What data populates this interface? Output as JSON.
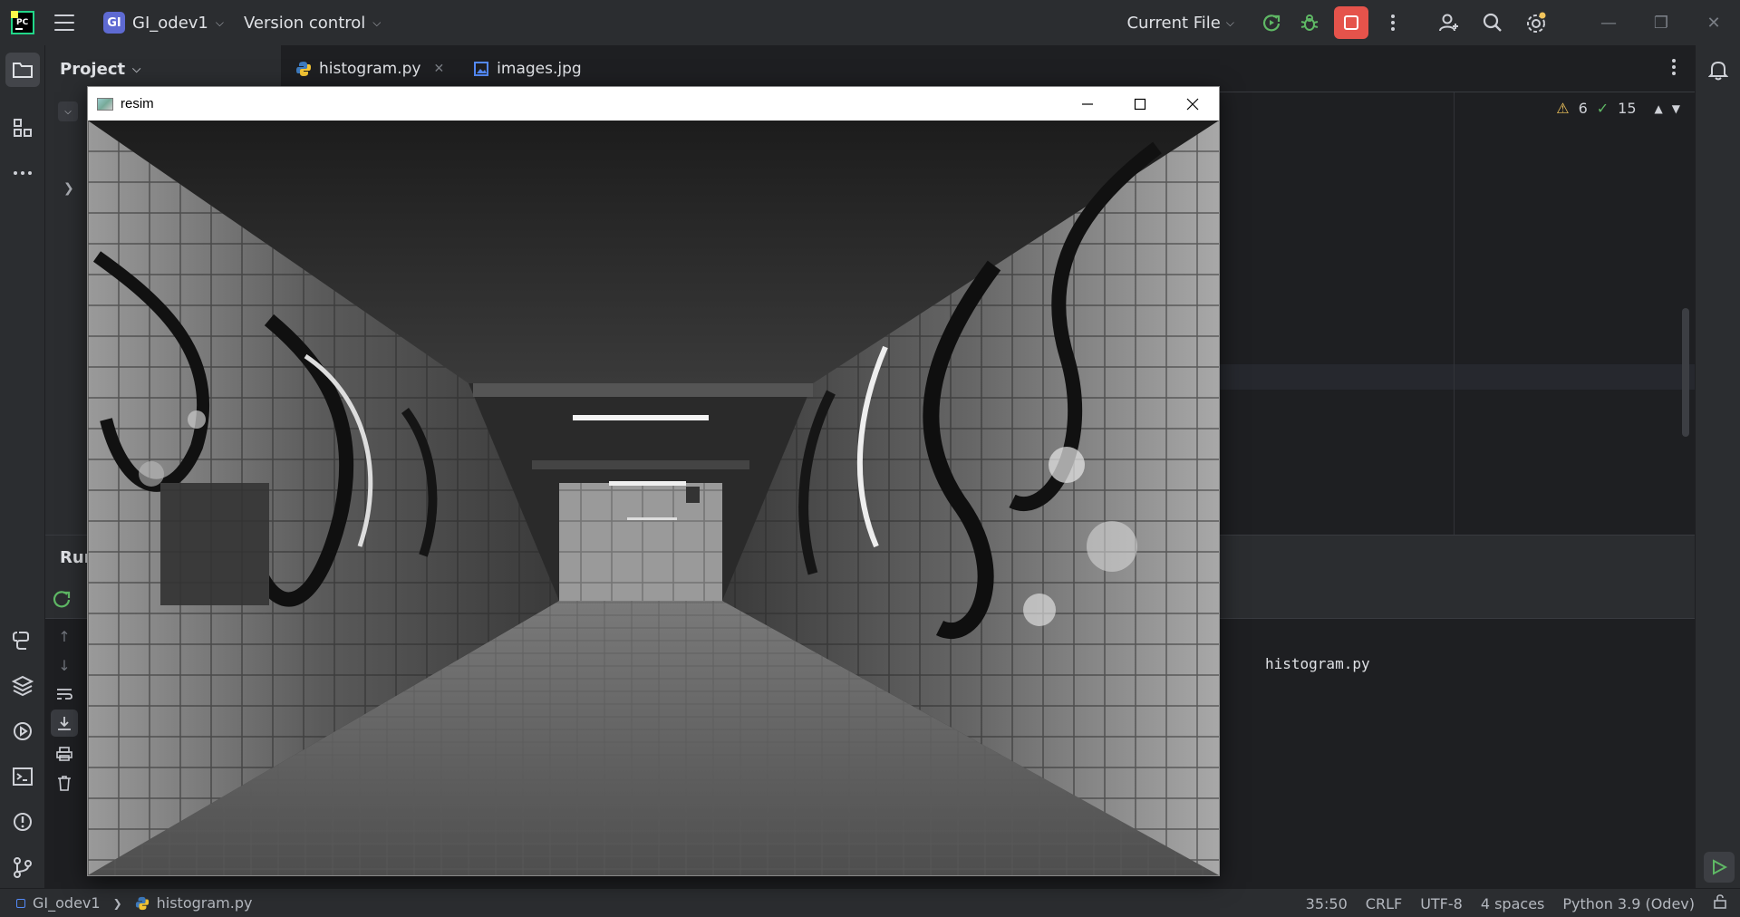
{
  "titlebar": {
    "project_badge": "GI",
    "project_name": "GI_odev1",
    "version_control": "Version control",
    "run_config": "Current File",
    "icons": [
      "pycharm-logo-icon",
      "hamburger-menu-icon",
      "run-icon",
      "debug-icon",
      "stop-icon",
      "more-vertical-icon",
      "add-user-icon",
      "search-icon",
      "settings-icon"
    ],
    "window": [
      "minimize",
      "restore",
      "close"
    ]
  },
  "project_panel": {
    "title": "Project"
  },
  "editor": {
    "tabs": [
      {
        "label": "histogram.py",
        "icon": "python-file-icon",
        "active": true
      },
      {
        "label": "images.jpg",
        "icon": "image-file-icon",
        "active": false
      }
    ],
    "warnings": "6",
    "weak_warnings": "15"
  },
  "run_panel": {
    "title": "Run",
    "console_text": "histogram.py"
  },
  "statusbar": {
    "project": "GI_odev1",
    "file": "histogram.py",
    "position": "35:50",
    "line_sep": "CRLF",
    "encoding": "UTF-8",
    "indent": "4 spaces",
    "interpreter": "Python 3.9 (Odev)"
  },
  "resim_window": {
    "title": "resim",
    "image_description_icon": "image-icon"
  },
  "colors": {
    "accent": "#3574f0",
    "stop": "#e5534b",
    "run_green": "#5fb865",
    "warning": "#f2c55c"
  }
}
